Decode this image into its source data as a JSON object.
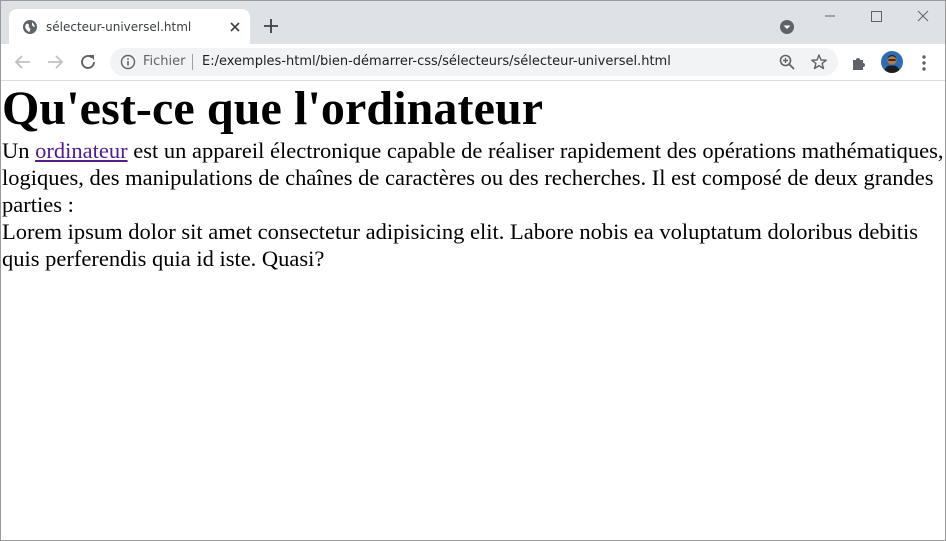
{
  "browser": {
    "tab": {
      "title": "sélecteur-universel.html",
      "favicon": "globe-icon"
    },
    "new_tab_icon": "plus-icon",
    "window_controls": [
      "minimize-icon",
      "maximize-icon",
      "close-icon"
    ],
    "address": {
      "scheme_label": "Fichier",
      "url": "E:/exemples-html/bien-démarrer-css/sélecteurs/sélecteur-universel.html"
    },
    "toolbar_icons": [
      "back-icon",
      "forward-icon",
      "reload-icon",
      "info-icon",
      "zoom-icon",
      "star-icon",
      "extensions-icon",
      "avatar",
      "menu-icon"
    ]
  },
  "page": {
    "heading": "Qu'est-ce que l'ordinateur",
    "para1_prefix": "Un ",
    "para1_link": "ordinateur",
    "para1_suffix": " est un appareil électronique capable de réaliser rapidement des opérations mathématiques, logiques, des manipulations de chaînes de caractères ou des recherches. Il est composé de deux grandes parties :",
    "para2": "Lorem ipsum dolor sit amet consectetur adipisicing elit. Labore nobis ea voluptatum doloribus debitis quis perferendis quia id iste. Quasi?"
  },
  "colors": {
    "tabstrip": "#dee1e6",
    "omnibox": "#f1f3f4",
    "link_visited": "#551a8b"
  }
}
